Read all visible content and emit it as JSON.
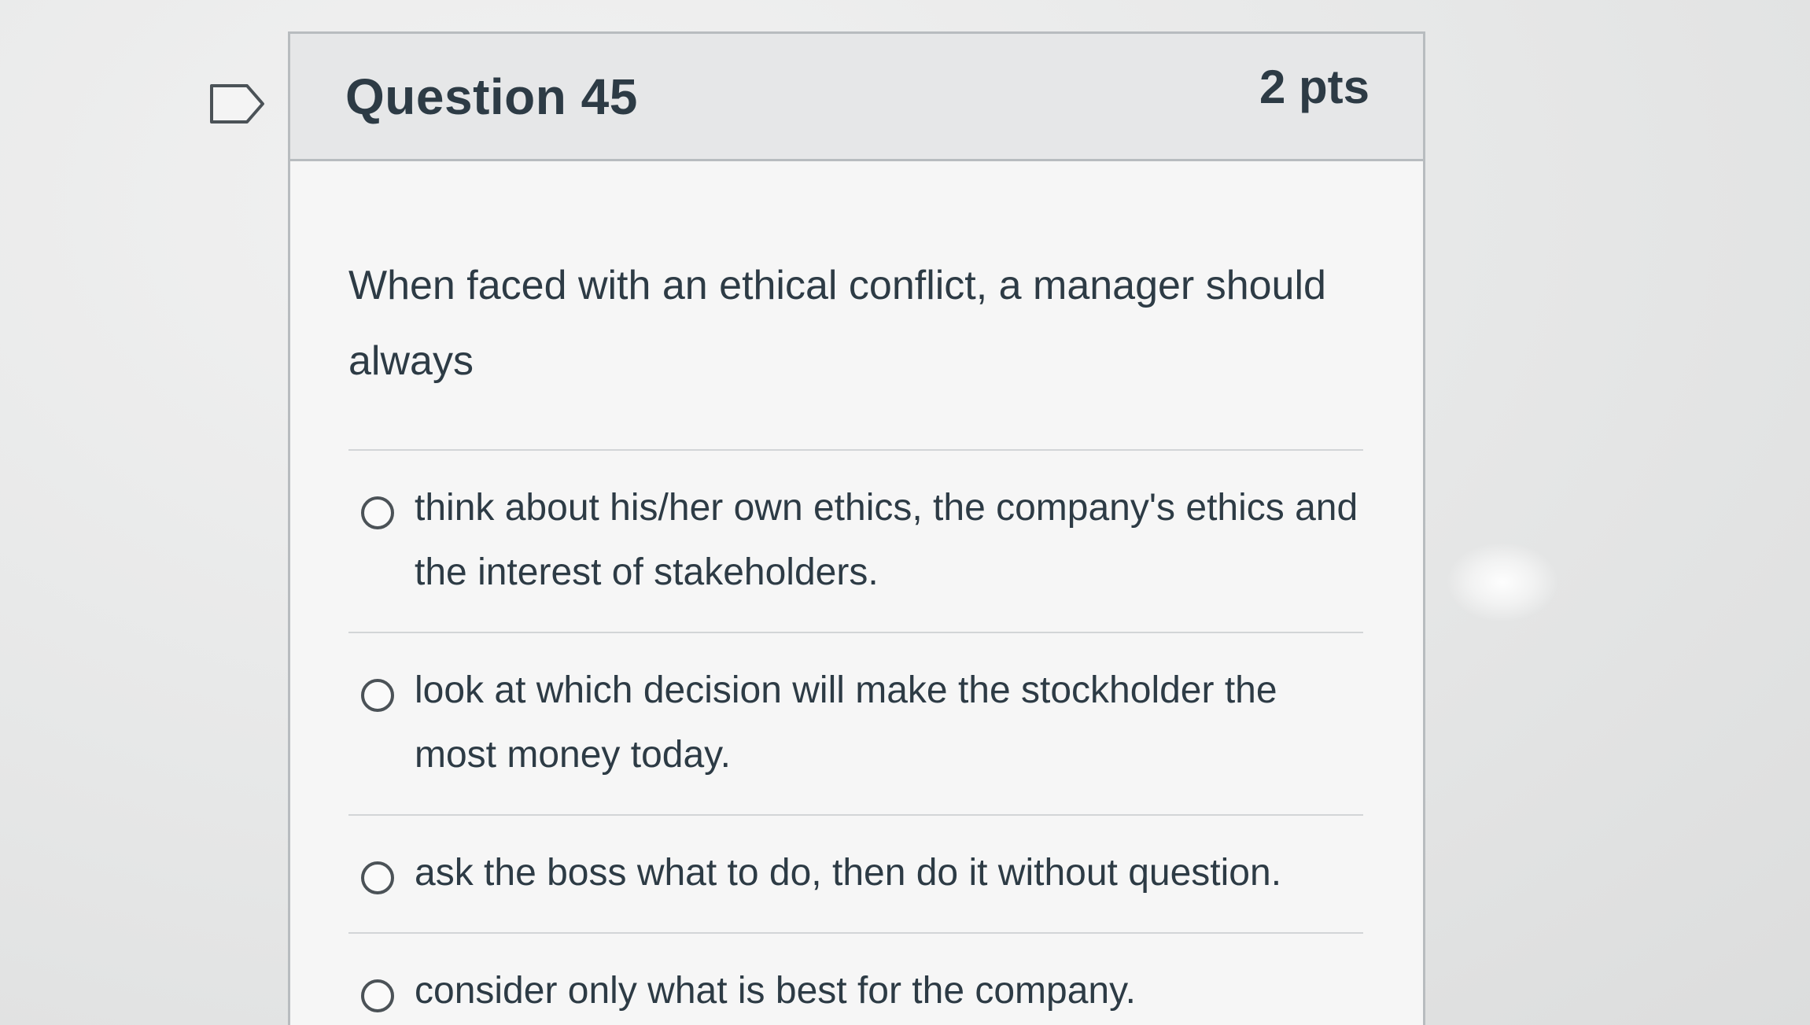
{
  "question": {
    "title": "Question 45",
    "points": "2 pts",
    "text": "When faced with an ethical conflict, a manager should always",
    "answers": [
      {
        "label": "think about his/her own ethics, the company's ethics and the interest of stakeholders."
      },
      {
        "label": "look at which decision will make the stockholder the most money today."
      },
      {
        "label": "ask the boss what to do, then do it without question."
      },
      {
        "label": "consider only what is best for the company."
      }
    ]
  },
  "icons": {
    "flag": "bookmark-flag-icon",
    "radio": "radio-button-icon"
  },
  "colors": {
    "text": "#2d3b45",
    "header_bg": "#e6e7e8",
    "border": "#b8bcbf"
  }
}
